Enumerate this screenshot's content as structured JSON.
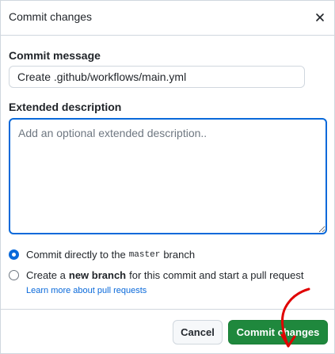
{
  "dialog": {
    "title": "Commit changes",
    "close_icon": "close-icon"
  },
  "commit_message": {
    "label": "Commit message",
    "value": "Create .github/workflows/main.yml"
  },
  "extended_description": {
    "label": "Extended description",
    "placeholder": "Add an optional extended description..",
    "value": ""
  },
  "branch_options": {
    "direct": {
      "prefix": "Commit directly to the",
      "branch_name": "master",
      "suffix": "branch",
      "checked": true
    },
    "new_branch": {
      "prefix": "Create a",
      "emphasis": "new branch",
      "suffix": "for this commit and start a pull request",
      "checked": false
    },
    "learn_more_link": "Learn more about pull requests"
  },
  "footer": {
    "cancel_label": "Cancel",
    "commit_label": "Commit changes"
  },
  "colors": {
    "primary_button": "#1f883d",
    "focus_border": "#0969da",
    "link": "#0969da",
    "annotation": "#e00000"
  }
}
